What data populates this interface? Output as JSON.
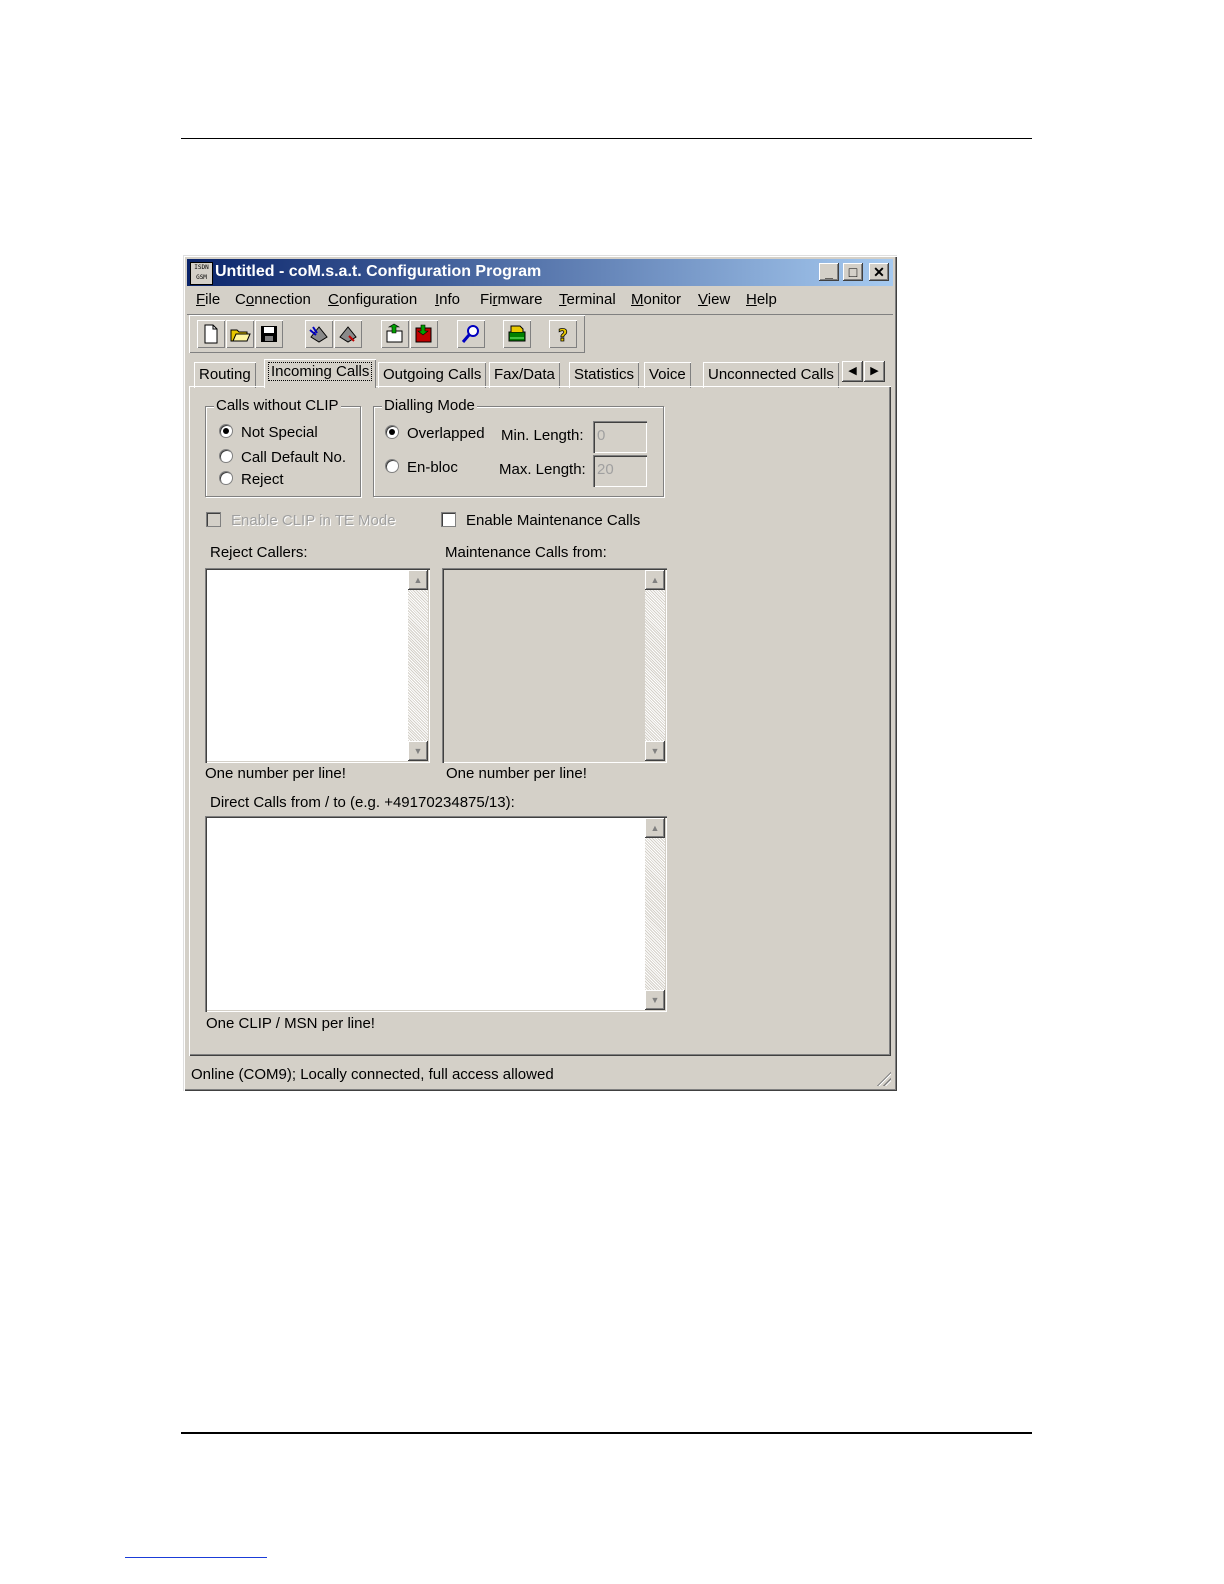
{
  "window": {
    "title": "Untitled - coM.s.a.t. Configuration Program",
    "app_icon_text": "ISDN GSM",
    "minimize": "_",
    "maximize": "□",
    "close": "✕"
  },
  "menu": [
    {
      "pre": "",
      "u": "F",
      "post": "ile"
    },
    {
      "pre": "C",
      "u": "o",
      "post": "nnection"
    },
    {
      "pre": "",
      "u": "C",
      "post": "onfiguration"
    },
    {
      "pre": "",
      "u": "I",
      "post": "nfo"
    },
    {
      "pre": "Fi",
      "u": "r",
      "post": "mware"
    },
    {
      "pre": "",
      "u": "T",
      "post": "erminal"
    },
    {
      "pre": "",
      "u": "M",
      "post": "onitor"
    },
    {
      "pre": "",
      "u": "V",
      "post": "iew"
    },
    {
      "pre": "",
      "u": "H",
      "post": "elp"
    }
  ],
  "toolbar_icons": [
    "new-file-icon",
    "open-folder-icon",
    "save-disk-icon",
    "read-config-icon",
    "write-config-icon",
    "upload-icon",
    "download-icon",
    "search-icon",
    "sim-card-icon",
    "help-icon"
  ],
  "tabs": [
    "Routing",
    "Incoming Calls",
    "Outgoing Calls",
    "Fax/Data",
    "Statistics",
    "Voice",
    "Unconnected Calls"
  ],
  "active_tab": "Incoming Calls",
  "tab_scroll": {
    "left": "◀",
    "right": "▶"
  },
  "calls_without_clip": {
    "legend": "Calls without CLIP",
    "options": [
      "Not Special",
      "Call Default No.",
      "Reject"
    ],
    "selected": "Not Special"
  },
  "dialling_mode": {
    "legend": "Dialling Mode",
    "options": [
      "Overlapped",
      "En-bloc"
    ],
    "selected": "Overlapped",
    "min_length_label": "Min. Length:",
    "min_length_value": "0",
    "max_length_label": "Max. Length:",
    "max_length_value": "20"
  },
  "enable_clip_te": {
    "label": "Enable CLIP in TE Mode",
    "checked": false,
    "disabled": true
  },
  "enable_maintenance": {
    "label": "Enable Maintenance Calls",
    "checked": false
  },
  "reject_callers": {
    "label": "Reject Callers:",
    "hint": "One number per line!"
  },
  "maintenance_from": {
    "label": "Maintenance Calls from:",
    "hint": "One number per line!"
  },
  "direct_calls": {
    "label": "Direct Calls from / to (e.g. +49170234875/13):",
    "hint": "One CLIP / MSN per line!"
  },
  "scroll_arrows": {
    "up": "▲",
    "down": "▼"
  },
  "status": "Online (COM9); Locally connected, full access allowed",
  "colors": {
    "titlebar_start": "#0a246a",
    "titlebar_end": "#a6caf0",
    "face": "#d4d0c8"
  }
}
